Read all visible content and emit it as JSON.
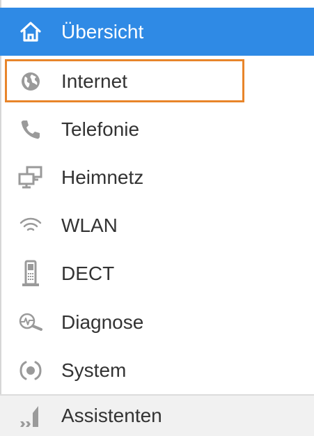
{
  "menu": {
    "items": [
      {
        "label": "Übersicht",
        "icon": "home-icon",
        "active": true
      },
      {
        "label": "Internet",
        "icon": "globe-icon",
        "highlighted": true
      },
      {
        "label": "Telefonie",
        "icon": "phone-icon"
      },
      {
        "label": "Heimnetz",
        "icon": "network-icon"
      },
      {
        "label": "WLAN",
        "icon": "wifi-icon"
      },
      {
        "label": "DECT",
        "icon": "dect-phone-icon"
      },
      {
        "label": "Diagnose",
        "icon": "diagnose-icon"
      },
      {
        "label": "System",
        "icon": "system-icon"
      },
      {
        "label": "Assistenten",
        "icon": "assistant-icon"
      }
    ]
  },
  "colors": {
    "active_bg": "#2f8ae5",
    "highlight_border": "#e8852a",
    "icon_gray": "#9a9a9a",
    "text": "#333333"
  }
}
